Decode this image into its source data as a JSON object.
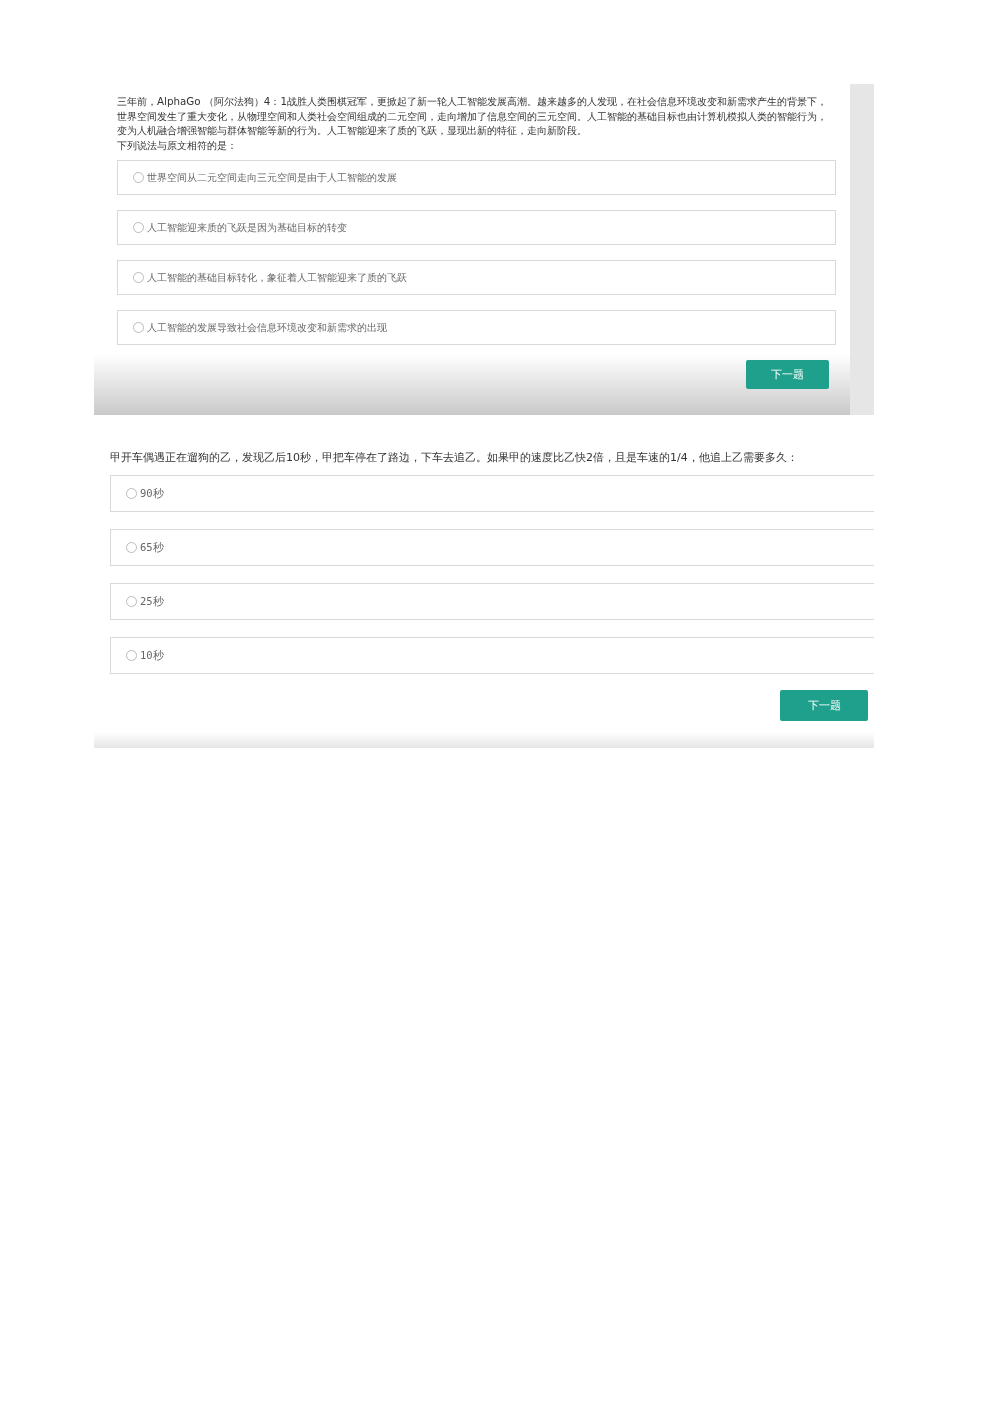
{
  "panels": [
    {
      "kind": "passage",
      "passage": "三年前，AlphaGo （阿尔法狗）4：1战胜人类围棋冠军，更掀起了新一轮人工智能发展高潮。越来越多的人发现，在社会信息环境改变和新需求产生的背景下，世界空间发生了重大变化，从物理空间和人类社会空间组成的二元空间，走向增加了信息空间的三元空间。人工智能的基础目标也由计算机模拟人类的智能行为，变为人机融合增强智能与群体智能等新的行为。人工智能迎来了质的飞跃，显现出新的特征，走向新阶段。",
      "question": "下列说法与原文相符的是：",
      "options": [
        {
          "label": "世界空间从二元空间走向三元空间是由于人工智能的发展",
          "selected": false
        },
        {
          "label": "人工智能迎来质的飞跃是因为基础目标的转变",
          "selected": false
        },
        {
          "label": "人工智能的基础目标转化，象征着人工智能迎来了质的飞跃",
          "selected": false
        },
        {
          "label": "人工智能的发展导致社会信息环境改变和新需求的出现",
          "selected": false
        }
      ],
      "next_button": "下一题"
    },
    {
      "kind": "plain",
      "question": "甲开车偶遇正在遛狗的乙，发现乙后10秒，甲把车停在了路边，下车去追乙。如果甲的速度比乙快2倍，且是车速的1/4，他追上乙需要多久：",
      "options": [
        {
          "label": "90秒",
          "selected": false
        },
        {
          "label": "65秒",
          "selected": false
        },
        {
          "label": "25秒",
          "selected": false
        },
        {
          "label": "10秒",
          "selected": false
        }
      ],
      "next_button": "下一题"
    }
  ]
}
